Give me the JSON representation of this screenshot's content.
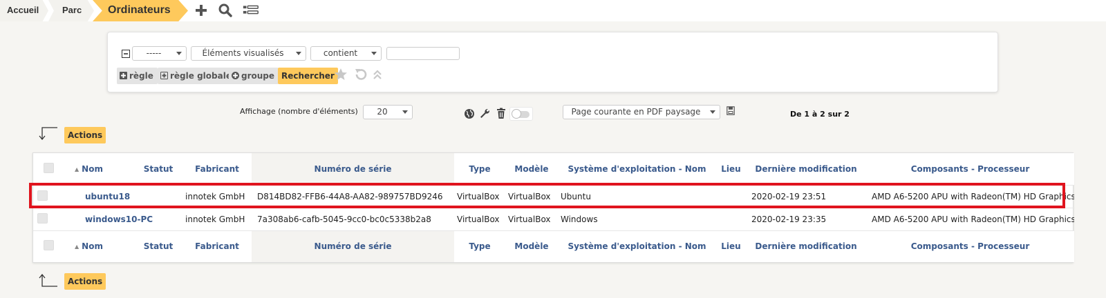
{
  "breadcrumb": {
    "home": "Accueil",
    "parc": "Parc",
    "current": "Ordinateurs"
  },
  "toolbar_icons": [
    "plus-icon",
    "search-icon",
    "list-icon"
  ],
  "search": {
    "field_select": "-----",
    "field_criterion": "Éléments visualisés",
    "operator": "contient",
    "value": "",
    "btn_rule": "règle",
    "btn_global_rule": "règle globale",
    "btn_group": "groupe",
    "btn_search": "Rechercher"
  },
  "display": {
    "label": "Affichage (nombre d'éléments)",
    "count": "20",
    "export_select": "Page courante en PDF paysage",
    "pagination": "De 1 à 2 sur 2"
  },
  "actions_label": "Actions",
  "table": {
    "columns": [
      "Nom",
      "Statut",
      "Fabricant",
      "Numéro de série",
      "Type",
      "Modèle",
      "Système d'exploitation - Nom",
      "Lieu",
      "Dernière modification",
      "Composants - Processeur"
    ],
    "rows": [
      {
        "name": "ubuntu18",
        "status": "",
        "manufacturer": "innotek GmbH",
        "serial": "D814BD82-FFB6-44A8-AA82-989757BD9246",
        "type": "VirtualBox",
        "model": "VirtualBox",
        "os": "Ubuntu",
        "location": "",
        "modified": "2020-02-19 23:51",
        "cpu": "AMD A6-5200 APU with Radeon(TM) HD Graphics"
      },
      {
        "name": "windows10-PC",
        "status": "",
        "manufacturer": "innotek GmbH",
        "serial": "7a308ab6-cafb-5045-9cc0-bc0c5338b2a8",
        "type": "VirtualBox",
        "model": "VirtualBox",
        "os": "Windows",
        "location": "",
        "modified": "2020-02-19 23:35",
        "cpu": "AMD A6-5200 APU with Radeon(TM) HD Graphics"
      }
    ]
  },
  "colors": {
    "accent": "#fec95c",
    "link": "#3a5a8c",
    "highlight": "#e0141e"
  }
}
